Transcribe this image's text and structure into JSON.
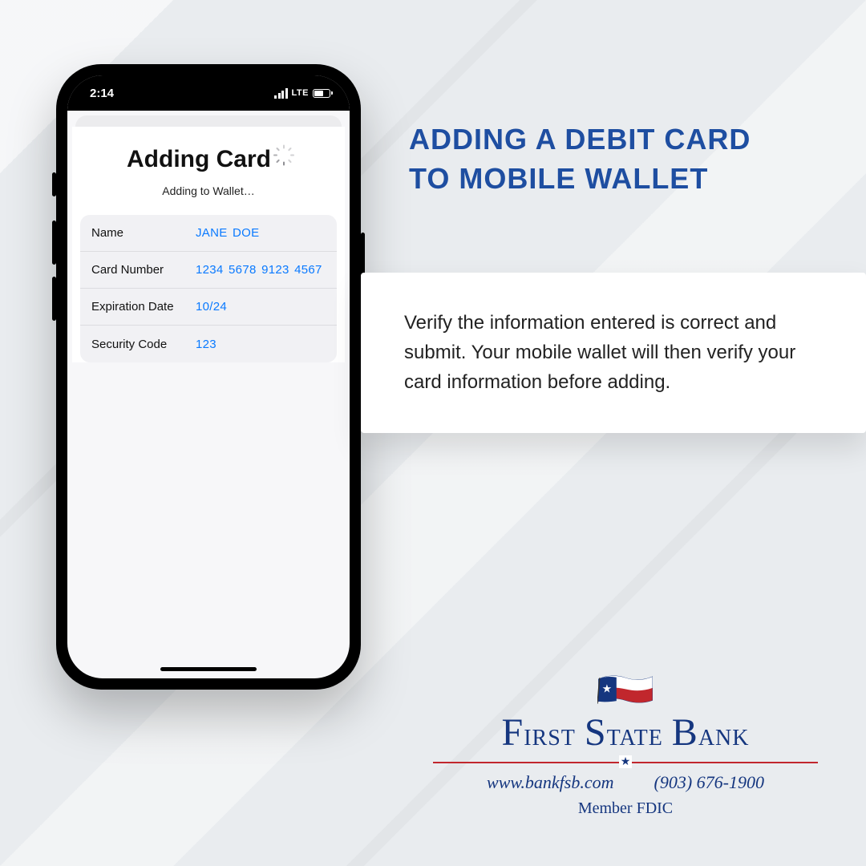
{
  "phone": {
    "status_time": "2:14",
    "status_network": "LTE",
    "screen_title": "Adding Card",
    "screen_subtitle": "Adding to Wallet…",
    "form": {
      "name_label": "Name",
      "name_value": "JANE DOE",
      "card_label": "Card Number",
      "card_value": "1234 5678 9123 4567",
      "exp_label": "Expiration Date",
      "exp_value": "10/24",
      "cvv_label": "Security Code",
      "cvv_value": "123"
    }
  },
  "headline_line1": "Adding a debit card",
  "headline_line2": "to mobile wallet",
  "info_text": "Verify the information entered is correct and submit. Your mobile wallet will then verify your card information before adding.",
  "footer": {
    "bank_name": "First State Bank",
    "url": "www.bankfsb.com",
    "phone": "(903) 676-1900",
    "member": "Member FDIC"
  }
}
